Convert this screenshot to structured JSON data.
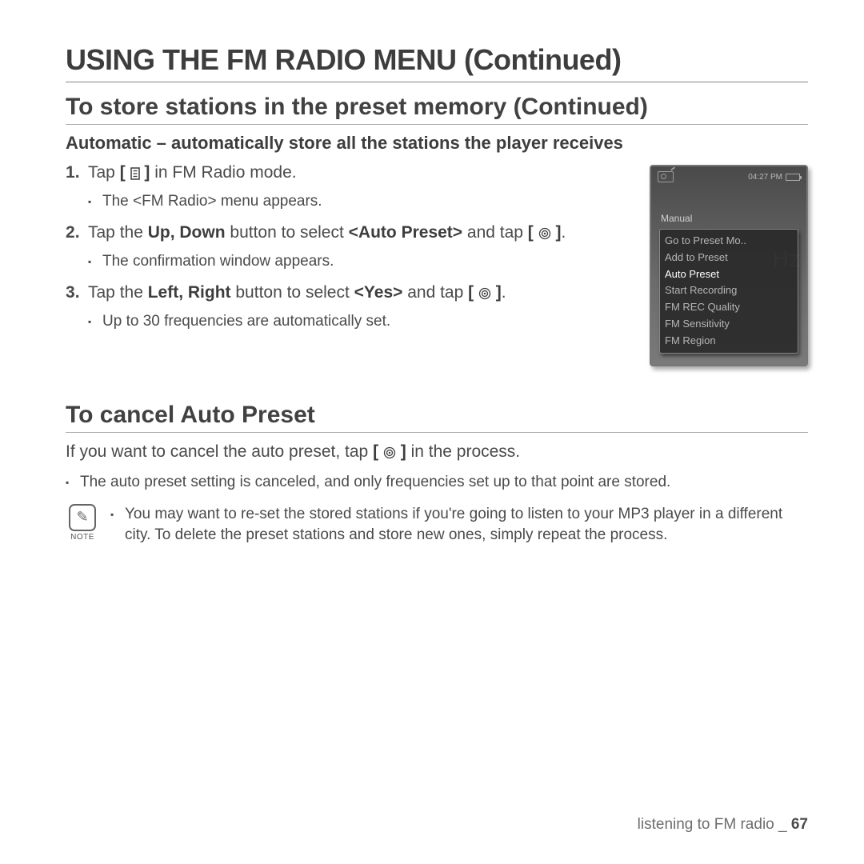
{
  "page_title": "USING THE FM RADIO MENU (Continued)",
  "section1_title": "To store stations in the preset memory (Continued)",
  "subsection1_title": "Automatic – automatically store all the stations the player receives",
  "steps": {
    "s1_a": "Tap ",
    "s1_b": " in FM Radio mode.",
    "s1_sub": "The <FM Radio> menu appears.",
    "s2_a": "Tap the ",
    "s2_bold1": "Up, Down",
    "s2_b": " button to select ",
    "s2_bold2": "<Auto Preset>",
    "s2_c": " and tap ",
    "s2_d": ".",
    "s2_sub": "The confirmation window appears.",
    "s3_a": "Tap the ",
    "s3_bold1": "Left, Right",
    "s3_b": " button to select ",
    "s3_bold2": "<Yes>",
    "s3_c": " and tap ",
    "s3_d": ".",
    "s3_sub": "Up to 30 frequencies are automatically set."
  },
  "section2_title": "To cancel Auto Preset",
  "cancel": {
    "p_a": "If you want to cancel the auto preset, tap ",
    "p_b": " in the process.",
    "sub": "The auto preset setting is canceled, and only frequencies set up to that point are stored."
  },
  "note": {
    "label": "NOTE",
    "text": "You may want to re-set the stored stations if you're going to listen to your MP3 player in a different city. To delete the preset stations and store new ones, simply repeat the process."
  },
  "device": {
    "time": "04:27 PM",
    "mode": "Manual",
    "bg_unit": "Hz",
    "menu": [
      "Go to Preset Mo..",
      "Add to Preset",
      "Auto Preset",
      "Start Recording",
      "FM REC Quality",
      "FM Sensitivity",
      "FM Region"
    ],
    "selected_index": 2
  },
  "footer": {
    "text": "listening to FM radio _ ",
    "page": "67"
  }
}
